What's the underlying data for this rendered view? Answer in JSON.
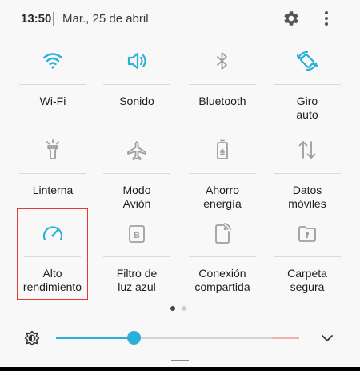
{
  "status": {
    "time": "13:50",
    "date": "Mar., 25 de abril"
  },
  "tiles": [
    {
      "label": [
        "Wi-Fi"
      ],
      "icon": "wifi-icon",
      "active": true
    },
    {
      "label": [
        "Sonido"
      ],
      "icon": "sound-icon",
      "active": true
    },
    {
      "label": [
        "Bluetooth"
      ],
      "icon": "bluetooth-icon",
      "active": false
    },
    {
      "label": [
        "Giro",
        "auto"
      ],
      "icon": "auto-rotate-icon",
      "active": true
    },
    {
      "label": [
        "Linterna"
      ],
      "icon": "flashlight-icon",
      "active": false
    },
    {
      "label": [
        "Modo",
        "Avión"
      ],
      "icon": "airplane-icon",
      "active": false
    },
    {
      "label": [
        "Ahorro",
        "energía"
      ],
      "icon": "battery-saver-icon",
      "active": false
    },
    {
      "label": [
        "Datos",
        "móviles"
      ],
      "icon": "mobile-data-icon",
      "active": false
    },
    {
      "label": [
        "Alto",
        "rendimiento"
      ],
      "icon": "performance-gauge-icon",
      "active": true,
      "highlighted": true
    },
    {
      "label": [
        "Filtro de",
        "luz azul"
      ],
      "icon": "blue-light-filter-icon",
      "active": false
    },
    {
      "label": [
        "Conexión",
        "compartida"
      ],
      "icon": "hotspot-icon",
      "active": false
    },
    {
      "label": [
        "Carpeta",
        "segura"
      ],
      "icon": "secure-folder-icon",
      "active": false
    }
  ],
  "pages": {
    "total": 2,
    "current": 1
  },
  "brightness": {
    "level": 0.32
  },
  "colors": {
    "accent": "#2ab0d9",
    "inactive_icon": "#9e9e9e",
    "highlight": "#e53935"
  }
}
